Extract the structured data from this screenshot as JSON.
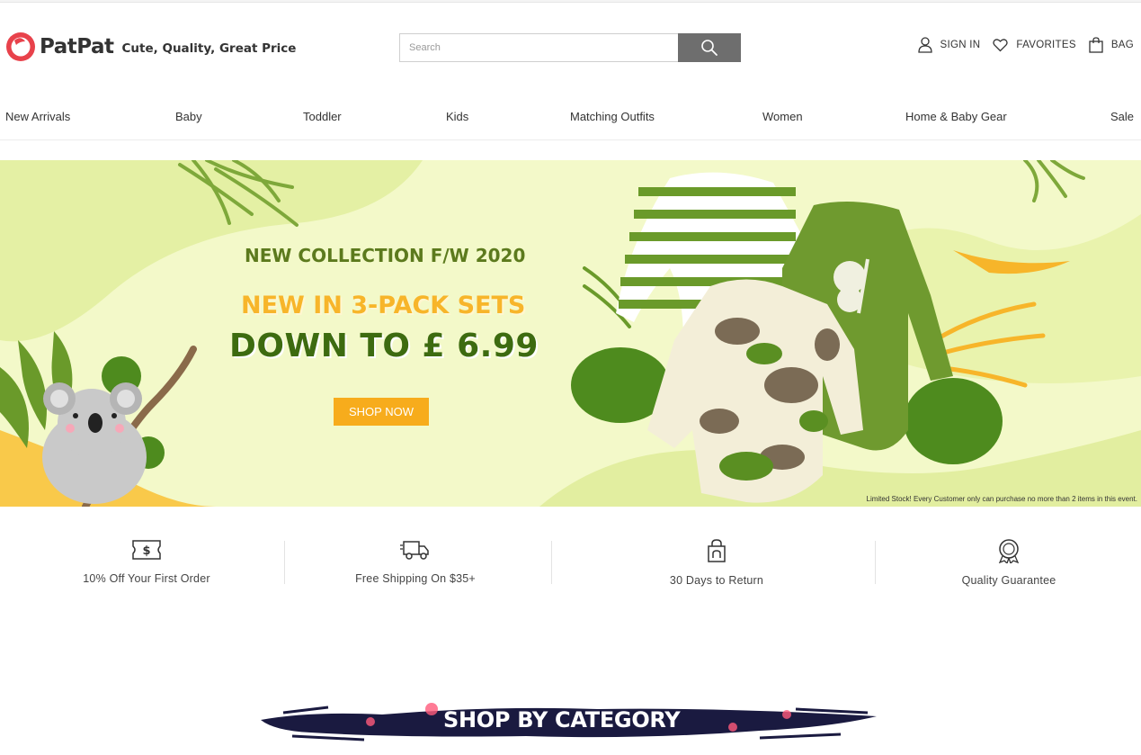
{
  "header": {
    "logo_text": "PatPat",
    "tagline": "Cute, Quality, Great Price",
    "search_placeholder": "Search",
    "account": [
      {
        "label": "SIGN IN",
        "icon": "user-icon"
      },
      {
        "label": "FAVORITES",
        "icon": "heart-icon"
      },
      {
        "label": "BAG",
        "icon": "bag-icon"
      }
    ]
  },
  "nav": [
    "New Arrivals",
    "Baby",
    "Toddler",
    "Kids",
    "Matching Outfits",
    "Women",
    "Home & Baby Gear",
    "Sale"
  ],
  "banner": {
    "subtitle": "NEW COLLECTION F/W 2020",
    "headline": "NEW IN 3-PACK SETS",
    "price": "DOWN TO  £ 6.99",
    "cta": "SHOP NOW",
    "note": "Limited Stock! Every Customer only can purchase no more than 2 items in this event."
  },
  "features": [
    {
      "label": "10% Off Your First Order",
      "icon": "coupon-icon"
    },
    {
      "label": "Free Shipping On $35+",
      "icon": "truck-icon"
    },
    {
      "label": "30 Days to Return",
      "icon": "return-bag-icon"
    },
    {
      "label": "Quality Guarantee",
      "icon": "badge-icon"
    }
  ],
  "category_title": "SHOP BY CATEGORY",
  "colors": {
    "brand": "#e8424b",
    "banner_bg": "#f3f9c9",
    "accent_orange": "#f7ac1c",
    "dark_green": "#3d6b10"
  }
}
